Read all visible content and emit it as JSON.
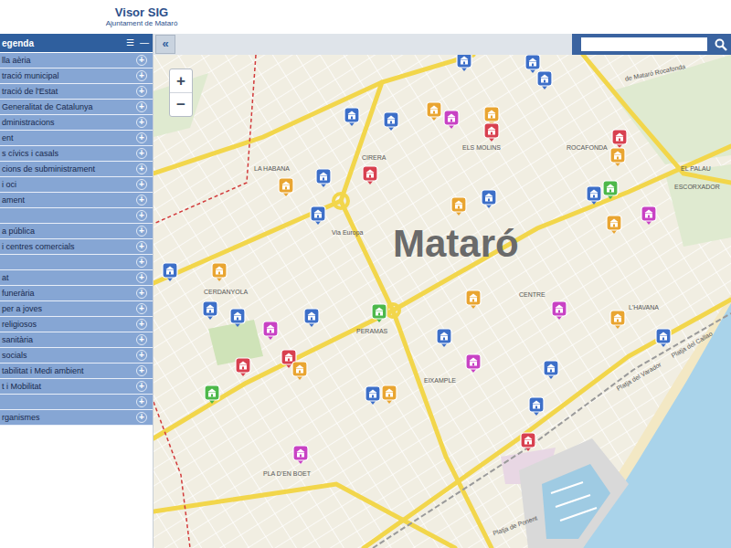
{
  "header": {
    "title": "Visor SIG",
    "subtitle": "Ajuntament de Mataró"
  },
  "legend": {
    "title": "egenda",
    "list_icon": "☰",
    "collapse_icon": "—",
    "items": [
      {
        "label": "lla aèria",
        "toggle": "+"
      },
      {
        "label": "tració municipal",
        "toggle": "+"
      },
      {
        "label": "tració de l'Estat",
        "toggle": "+"
      },
      {
        "label": "Generalitat de Catalunya",
        "toggle": "+"
      },
      {
        "label": "dministracions",
        "toggle": "+"
      },
      {
        "label": "ent",
        "toggle": "+"
      },
      {
        "label": "s cívics i casals",
        "toggle": "+"
      },
      {
        "label": "cions de subministrament",
        "toggle": "+"
      },
      {
        "label": "i oci",
        "toggle": "+"
      },
      {
        "label": "ament",
        "toggle": "+"
      },
      {
        "label": "",
        "toggle": "+"
      },
      {
        "label": "a pública",
        "toggle": "+"
      },
      {
        "label": "i centres comercials",
        "toggle": "+"
      },
      {
        "label": "",
        "toggle": "+"
      },
      {
        "label": "at",
        "toggle": "+"
      },
      {
        "label": "funerària",
        "toggle": "+"
      },
      {
        "label": "per a joves",
        "toggle": "+"
      },
      {
        "label": "religiosos",
        "toggle": "+"
      },
      {
        "label": "sanitària",
        "toggle": "+"
      },
      {
        "label": "socials",
        "toggle": "+"
      },
      {
        "label": "tabilitat i Medi ambient",
        "toggle": "+"
      },
      {
        "label": "t i Mobilitat",
        "toggle": "+"
      },
      {
        "label": "",
        "toggle": "+"
      },
      {
        "label": "rganismes",
        "toggle": "+"
      }
    ]
  },
  "toolbar": {
    "collapse": "«"
  },
  "zoom": {
    "in": "+",
    "out": "−"
  },
  "map": {
    "title": "Mataró",
    "labels": [
      "EL PALAU",
      "ESCORXADOR",
      "de Mataró Rocafonda",
      "ROCAFONDA",
      "ELS MOLINS",
      "CIRERA",
      "LA HABANA",
      "Via Europa",
      "CERDANYOLA",
      "PERAMAS",
      "CENTRE",
      "L'HAVANA",
      "EIXAMPLE",
      "PLA D'EN BOET",
      "Platja del Callao",
      "Platja del Varador",
      "Platja de Ponent"
    ],
    "pins": [
      {
        "color": "#3d6fc8"
      },
      {
        "color": "#3d6fc8"
      },
      {
        "color": "#3d6fc8"
      },
      {
        "color": "#3d6fc8"
      },
      {
        "color": "#3d6fc8"
      },
      {
        "color": "#e9a531"
      },
      {
        "color": "#c842c4"
      },
      {
        "color": "#e9a531"
      },
      {
        "color": "#d8404f"
      },
      {
        "color": "#d8404f"
      },
      {
        "color": "#e9a531"
      },
      {
        "color": "#d8404f"
      },
      {
        "color": "#3d6fc8"
      },
      {
        "color": "#e9a531"
      },
      {
        "color": "#e9a531"
      },
      {
        "color": "#3d6fc8"
      },
      {
        "color": "#3d6fc8"
      },
      {
        "color": "#4db84a"
      },
      {
        "color": "#3d6fc8"
      },
      {
        "color": "#c842c4"
      },
      {
        "color": "#e9a531"
      },
      {
        "color": "#3d6fc8"
      },
      {
        "color": "#e9a531"
      },
      {
        "color": "#e9a531"
      },
      {
        "color": "#c842c4"
      },
      {
        "color": "#4db84a"
      },
      {
        "color": "#3d6fc8"
      },
      {
        "color": "#3d6fc8"
      },
      {
        "color": "#3d6fc8"
      },
      {
        "color": "#c842c4"
      },
      {
        "color": "#e9a531"
      },
      {
        "color": "#3d6fc8"
      },
      {
        "color": "#3d6fc8"
      },
      {
        "color": "#d8404f"
      },
      {
        "color": "#d8404f"
      },
      {
        "color": "#e9a531"
      },
      {
        "color": "#c842c4"
      },
      {
        "color": "#3d6fc8"
      },
      {
        "color": "#4db84a"
      },
      {
        "color": "#3d6fc8"
      },
      {
        "color": "#e9a531"
      },
      {
        "color": "#3d6fc8"
      },
      {
        "color": "#d8404f"
      },
      {
        "color": "#c842c4"
      }
    ]
  }
}
